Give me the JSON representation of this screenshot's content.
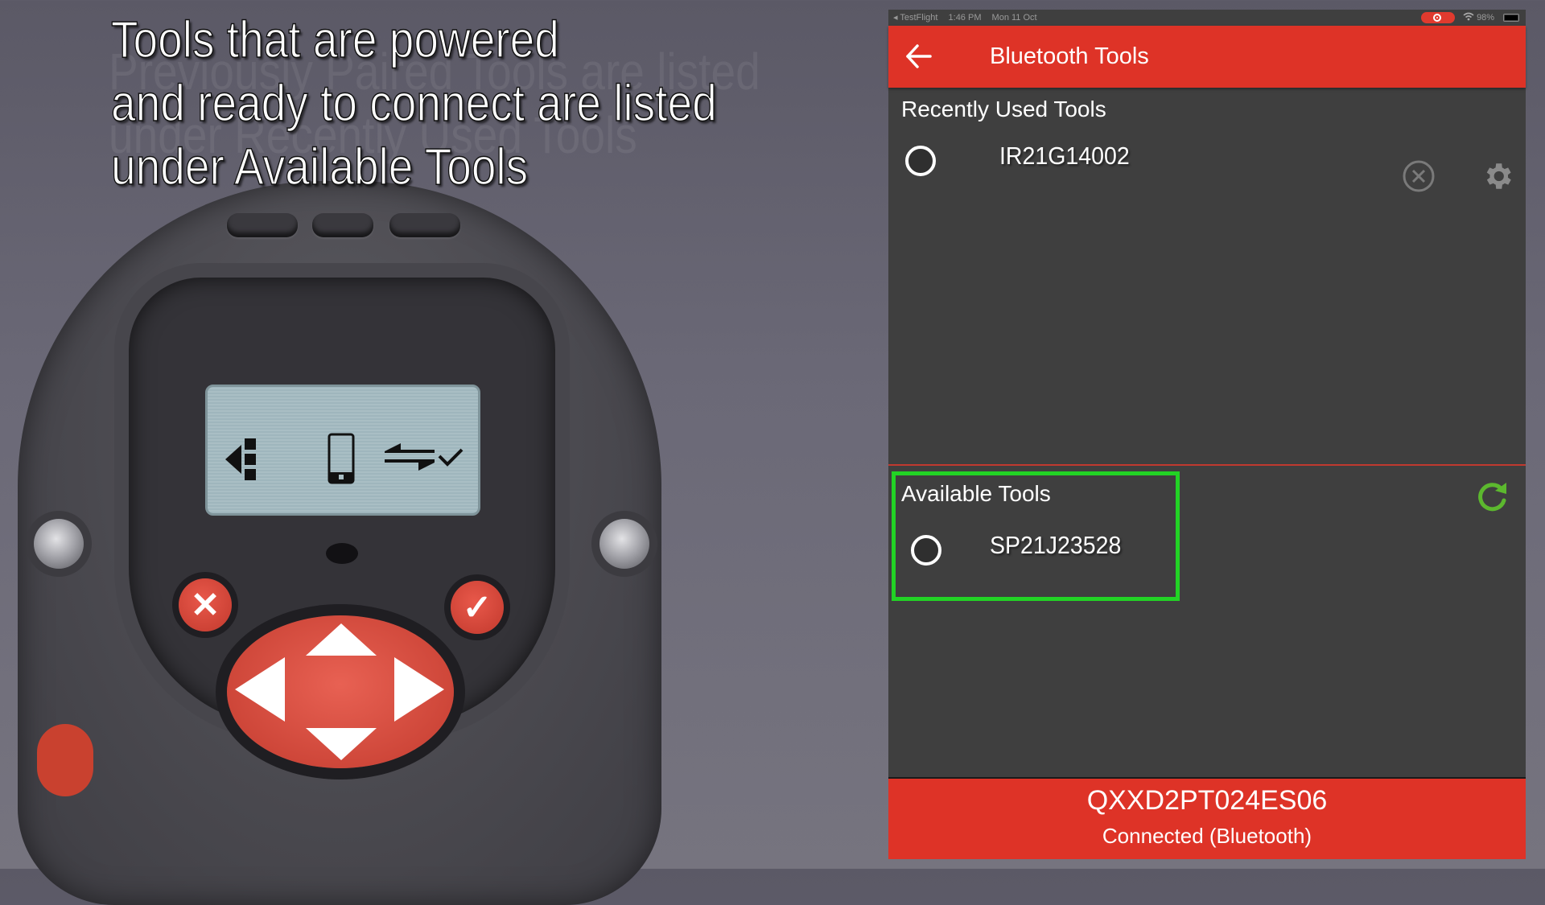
{
  "caption": {
    "lines": [
      "Tools that are powered",
      "and ready to connect are listed",
      "under Available Tools"
    ],
    "ghost_lines": [
      "Previously Paired Tools are listed",
      "under Recently Used Tools"
    ]
  },
  "device": {
    "lcd_icons": [
      "exit-icon",
      "phone-icon",
      "transfer-check-icon"
    ],
    "cancel_symbol": "✕",
    "confirm_symbol": "✓"
  },
  "statusbar": {
    "back_app": "◂ TestFlight",
    "time": "1:46 PM",
    "date": "Mon 11 Oct",
    "battery": "98%"
  },
  "app": {
    "title": "Bluetooth Tools",
    "recent": {
      "title": "Recently Used Tools",
      "items": [
        {
          "id": "IR21G14002",
          "selected": false
        }
      ]
    },
    "available": {
      "title": "Available Tools",
      "items": [
        {
          "id": "SP21J23528",
          "selected": false
        }
      ]
    },
    "footer": {
      "device_id": "QXXD2PT024ES06",
      "status": "Connected (Bluetooth)"
    }
  },
  "colors": {
    "brand_red": "#de3327",
    "panel_bg": "#3f3f3f",
    "highlight_green": "#22d325",
    "refresh_green": "#5cb82e",
    "icon_grey": "#8a8a8a"
  }
}
